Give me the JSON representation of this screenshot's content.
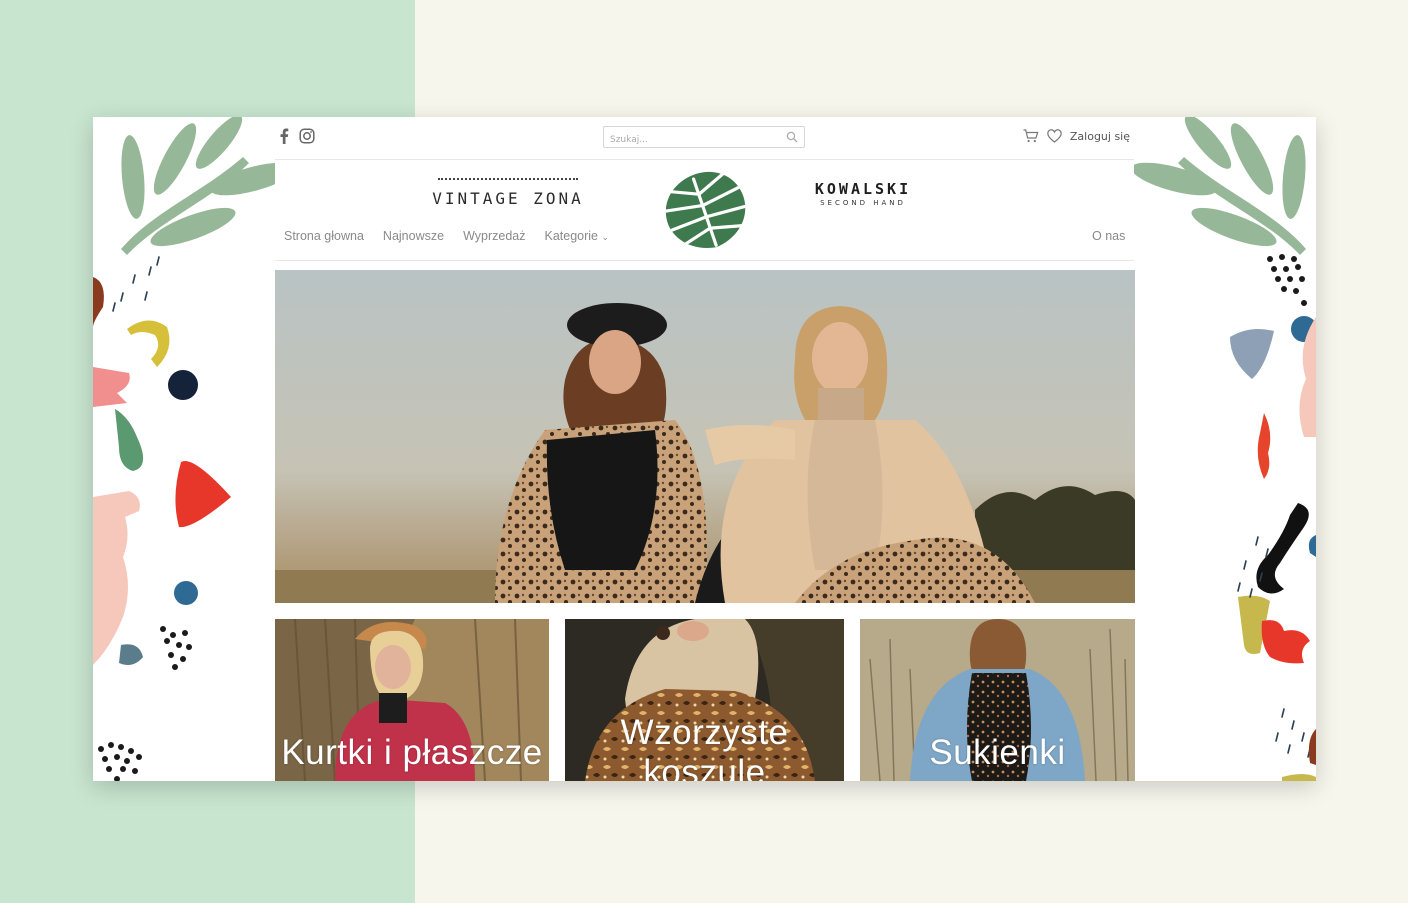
{
  "header": {
    "social": [
      {
        "icon": "facebook-icon"
      },
      {
        "icon": "instagram-icon"
      }
    ],
    "search": {
      "placeholder": "Szukaj..."
    },
    "login_label": "Zaloguj się"
  },
  "brands": {
    "left_logo": "VINTAGE ZONA",
    "right_logo_main": "KOWALSKI",
    "right_logo_sub": "SECOND HAND"
  },
  "nav": {
    "items": [
      "Strona głowna",
      "Najnowsze",
      "Wyprzedaż",
      "Kategorie"
    ],
    "right_item": "O nas"
  },
  "categories": [
    {
      "label": "Kurtki i płaszcze"
    },
    {
      "label": "Wzorzyste koszule"
    },
    {
      "label": "Sukienki"
    }
  ],
  "colors": {
    "page_left": "#c7e5cf",
    "page_right": "#f6f6ec",
    "leaf_green": "#3e7a4d",
    "nav_text": "#8a8a8a"
  }
}
